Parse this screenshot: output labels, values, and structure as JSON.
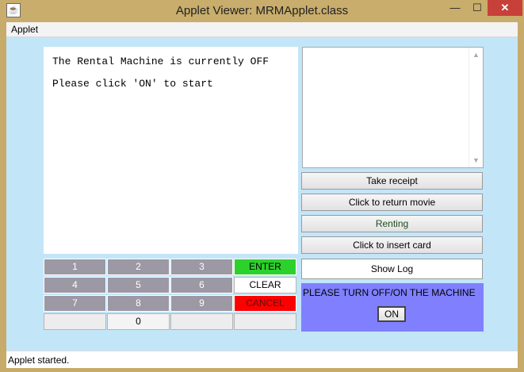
{
  "window": {
    "title": "Applet Viewer: MRMApplet.class",
    "icon": "java-cup-icon",
    "controls": {
      "minimize": "—",
      "maximize": "☐",
      "close": "✕"
    }
  },
  "menubar": {
    "items": [
      {
        "label": "Applet"
      }
    ]
  },
  "screen": {
    "line1": "The Rental Machine is currently OFF",
    "line2": "Please click 'ON' to start"
  },
  "side_buttons": {
    "take_receipt": "Take receipt",
    "return_movie": "Click to return movie",
    "renting": "Renting",
    "insert_card": "Click to insert card",
    "show_log": "Show Log"
  },
  "message_panel": {
    "text": "PLEASE TURN OFF/ON THE MACHINE",
    "on_button": "ON"
  },
  "keypad": {
    "k1": "1",
    "k2": "2",
    "k3": "3",
    "k4": "4",
    "k5": "5",
    "k6": "6",
    "k7": "7",
    "k8": "8",
    "k9": "9",
    "k0": "0",
    "enter": "ENTER",
    "clear": "CLEAR",
    "cancel": "CANCEL"
  },
  "status": {
    "text": "Applet started."
  },
  "colors": {
    "client_bg": "#c3e5f8",
    "keypad_grey": "#9c98a4",
    "enter": "#2cd12c",
    "cancel": "#ff0000",
    "message_panel": "#8080ff"
  }
}
